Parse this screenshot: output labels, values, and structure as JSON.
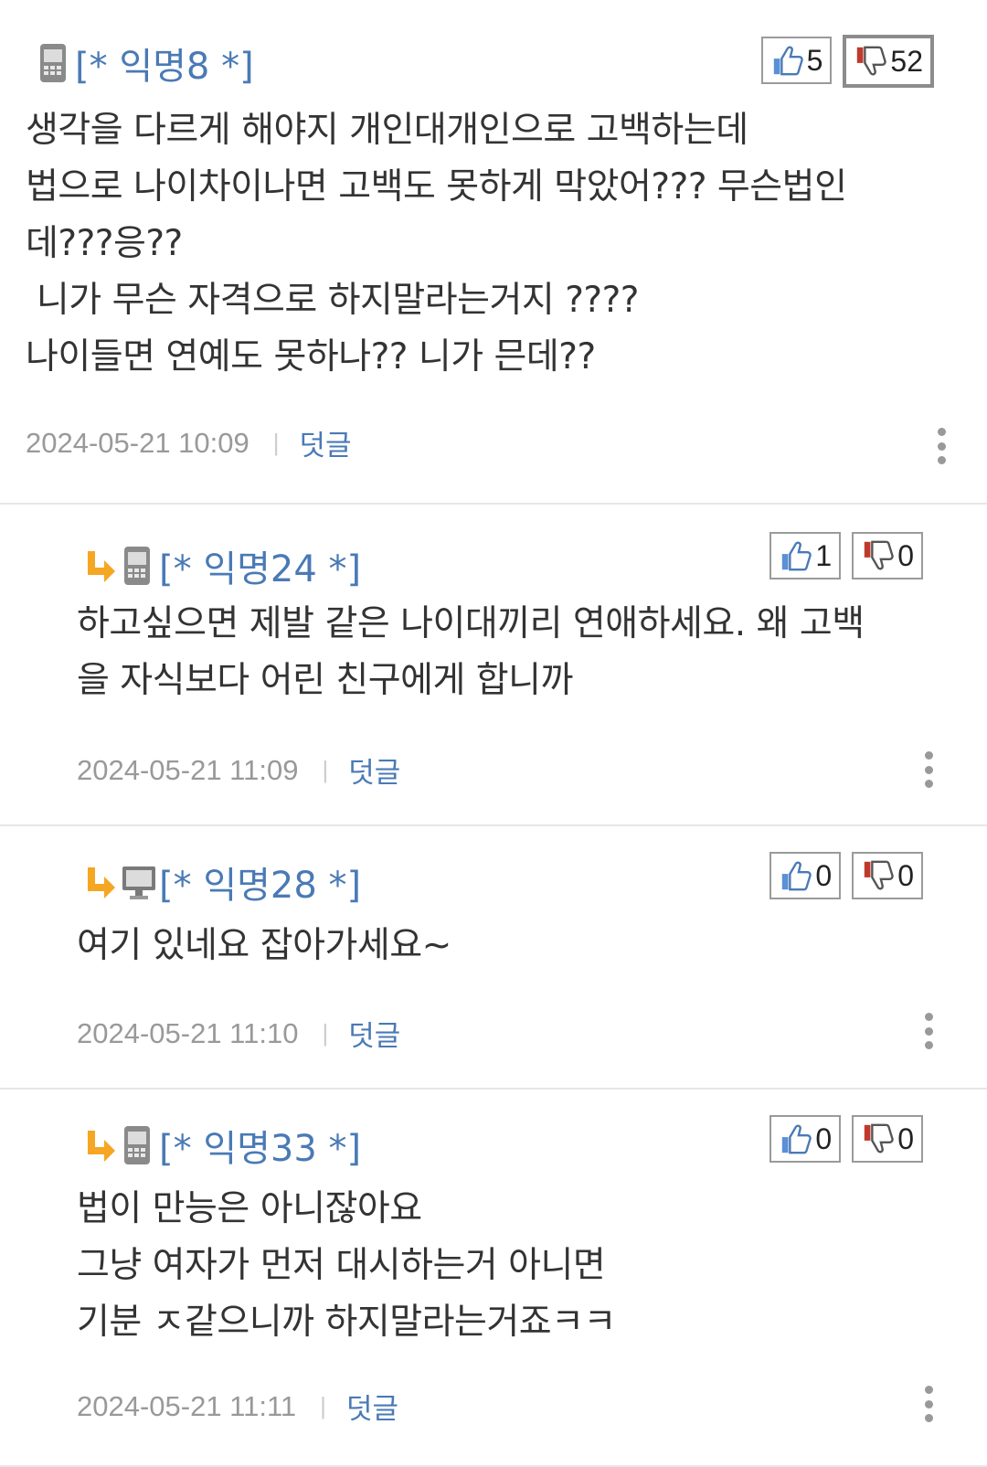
{
  "comments": [
    {
      "author": "[* 익명8 *]",
      "device": "phone-icon",
      "is_reply": false,
      "likes": "5",
      "dislikes": "52",
      "body": "생각을 다르게 해야지 개인대개인으로 고백하는데\n법으로 나이차이나면 고백도 못하게 막았어??? 무슨법인\n데???응??\n 니가 무슨 자격으로 하지말라는거지 ????\n나이들면 연예도 못하나?? 니가 믄데??",
      "timestamp": "2024-05-21 10:09",
      "reply_label": "덧글"
    },
    {
      "author": "[* 익명24 *]",
      "device": "phone-icon",
      "is_reply": true,
      "likes": "1",
      "dislikes": "0",
      "body": "하고싶으면 제발 같은 나이대끼리 연애하세요. 왜 고백\n을 자식보다 어린 친구에게 합니까",
      "timestamp": "2024-05-21 11:09",
      "reply_label": "덧글"
    },
    {
      "author": "[* 익명28 *]",
      "device": "monitor-icon",
      "is_reply": true,
      "likes": "0",
      "dislikes": "0",
      "body": "여기 있네요 잡아가세요~",
      "timestamp": "2024-05-21 11:10",
      "reply_label": "덧글"
    },
    {
      "author": "[* 익명33 *]",
      "device": "phone-icon",
      "is_reply": true,
      "likes": "0",
      "dislikes": "0",
      "body": "법이 만능은 아니잖아요\n그냥 여자가 먼저 대시하는거 아니면\n기분 ㅈ같으니까 하지말라는거죠ㅋㅋ",
      "timestamp": "2024-05-21 11:11",
      "reply_label": "덧글"
    }
  ],
  "colors": {
    "author": "#4a7ab5",
    "body": "#333333",
    "meta": "#999999",
    "reply_arrow": "#f5a623",
    "divider": "#e6e6e6"
  }
}
